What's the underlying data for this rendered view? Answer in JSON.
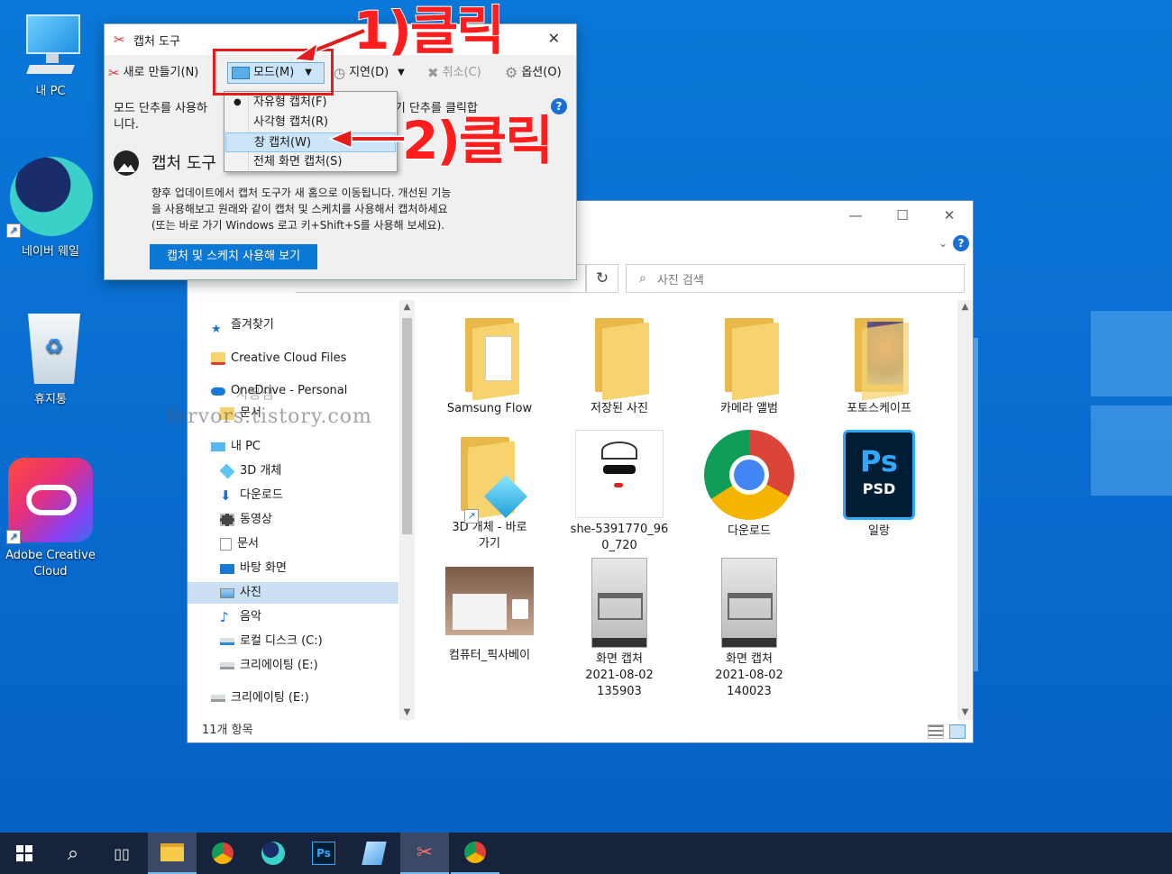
{
  "desktop": {
    "icons": [
      {
        "label": "내 PC"
      },
      {
        "label": "네이버 웨일"
      },
      {
        "label": "휴지통"
      },
      {
        "label": "Adobe Creative Cloud"
      }
    ]
  },
  "snip": {
    "title": "캡처 도구",
    "close": "✕",
    "new": "새로 만들기(N)",
    "mode": "모드(M)",
    "delay": "지연(D)",
    "cancel": "취소(C)",
    "options": "옵션(O)",
    "help_text": "모드 단추를 사용하여 캡처 유형을 선택하거나 새로 만들기 단추를 클릭합니다.",
    "help_line1": "모드 단추를 사용하",
    "help_line1b": "만들기 단추를 클릭합",
    "help_line2": "니다.",
    "heading": "캡처 도구",
    "body_text1": "향후 업데이트에서 캡처 도구가 새 홈으로 이동됩니다. 개선된 기능",
    "body_text2": "을 사용해보고 원래와 같이 캡처 및 스케치를 사용해서 캡처하세요",
    "body_text3": "(또는 바로 가기 Windows 로고 키+Shift+S를 사용해 보세요).",
    "cta": "캡처 및 스케치 사용해 보기"
  },
  "menu": {
    "items": [
      {
        "label": "자유형 캡처(F)",
        "checked": true
      },
      {
        "label": "사각형 캡처(R)",
        "checked": false
      },
      {
        "label": "창 캡처(W)",
        "checked": false,
        "highlight": true
      },
      {
        "label": "전체 화면 캡처(S)",
        "checked": false
      }
    ]
  },
  "annotations": {
    "step1": "1)클릭",
    "step2": "2)클릭"
  },
  "explorer": {
    "search_placeholder": "사진 검색",
    "refresh": "↻",
    "status": "11개 항목",
    "nav": [
      {
        "label": "즐겨찾기"
      },
      {
        "label": "Creative Cloud Files"
      },
      {
        "label": "OneDrive - Personal"
      },
      {
        "label": "문서"
      },
      {
        "label": "내 PC"
      },
      {
        "label": "3D 개체"
      },
      {
        "label": "다운로드"
      },
      {
        "label": "동영상"
      },
      {
        "label": "문서"
      },
      {
        "label": "바탕 화면"
      },
      {
        "label": "사진"
      },
      {
        "label": "음악"
      },
      {
        "label": "로컬 디스크 (C:)"
      },
      {
        "label": "크리에이팅 (E:)"
      },
      {
        "label": "크리에이팅 (E:)"
      }
    ],
    "files": [
      {
        "name": "Samsung Flow"
      },
      {
        "name": "저장된 사진"
      },
      {
        "name": "카메라 앨범"
      },
      {
        "name": "포토스케이프"
      },
      {
        "name": "3D 개체 - 바로 가기"
      },
      {
        "name": "she-5391770_960_720"
      },
      {
        "name": "다운로드"
      },
      {
        "name": "일랑"
      },
      {
        "name": "컴퓨터_픽사베이"
      },
      {
        "name": "화면 캡처 2021-08-02 135903"
      },
      {
        "name": "화면 캡처 2021-08-02 140023"
      }
    ]
  },
  "watermark": {
    "line1": "fervors.tistory.com",
    "line2": "자몽샘"
  },
  "taskbar": {
    "search": "⌕"
  },
  "colors": {
    "accent": "#0a78d4",
    "annotation": "#e41c1c",
    "desktop": "#0a6fd2",
    "taskbar": "#17233a"
  }
}
